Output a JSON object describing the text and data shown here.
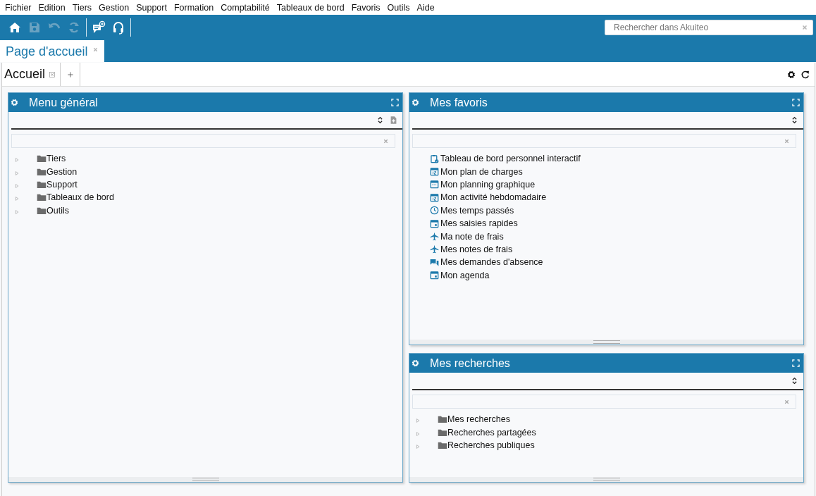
{
  "menu_bar": [
    "Fichier",
    "Edition",
    "Tiers",
    "Gestion",
    "Support",
    "Formation",
    "Comptabilité",
    "Tableaux de bord",
    "Favoris",
    "Outils",
    "Aide"
  ],
  "toolbar": {
    "buttons": [
      {
        "kind": "home",
        "disabled": false
      },
      {
        "kind": "save",
        "disabled": true
      },
      {
        "kind": "undo",
        "disabled": true
      },
      {
        "kind": "refresh",
        "disabled": true
      },
      {
        "kind": "separator"
      },
      {
        "kind": "chat-add",
        "disabled": false
      },
      {
        "kind": "headset",
        "disabled": false
      },
      {
        "kind": "separator"
      }
    ],
    "search": {
      "placeholder": "Rechercher dans Akuiteo"
    }
  },
  "page_tabs": [
    {
      "label": "Page d'accueil",
      "selected": true
    }
  ],
  "dashboard_tabs": [
    {
      "label": "Accueil",
      "selected": true
    }
  ],
  "left_column": [
    {
      "title": "Menu général",
      "tools": [
        {
          "kind": "sort"
        },
        {
          "kind": "new-document"
        }
      ],
      "items": [
        {
          "label": "Tiers",
          "kind": "folder",
          "expanded": false
        },
        {
          "label": "Gestion",
          "kind": "folder",
          "expanded": false
        },
        {
          "label": "Support",
          "kind": "folder",
          "expanded": false
        },
        {
          "label": "Tableaux de bord",
          "kind": "folder",
          "expanded": false
        },
        {
          "label": "Outils",
          "kind": "folder",
          "expanded": false
        }
      ]
    }
  ],
  "right_column": [
    {
      "title": "Mes favoris",
      "tools": [
        {
          "kind": "sort"
        }
      ],
      "items": [
        {
          "label": "Tableau de bord personnel interactif",
          "kind": "clipboard"
        },
        {
          "label": "Mon plan de charges",
          "kind": "calendar-number"
        },
        {
          "label": "Mon planning graphique",
          "kind": "calendar"
        },
        {
          "label": "Mon activité hebdomadaire",
          "kind": "calendar-number"
        },
        {
          "label": "Mes temps passés",
          "kind": "clock"
        },
        {
          "label": "Mes saisies rapides",
          "kind": "calendar-day"
        },
        {
          "label": "Ma note de frais",
          "kind": "plane"
        },
        {
          "label": "Mes notes de frais",
          "kind": "plane"
        },
        {
          "label": "Mes demandes d'absence",
          "kind": "chat"
        },
        {
          "label": "Mon agenda",
          "kind": "calendar-day"
        }
      ]
    },
    {
      "title": "Mes recherches",
      "tools": [
        {
          "kind": "sort"
        }
      ],
      "items": [
        {
          "label": "Mes recherches",
          "kind": "folder",
          "expanded": false
        },
        {
          "label": "Recherches partagées",
          "kind": "folder",
          "expanded": false
        },
        {
          "label": "Recherches publiques",
          "kind": "folder",
          "expanded": false
        }
      ]
    }
  ]
}
